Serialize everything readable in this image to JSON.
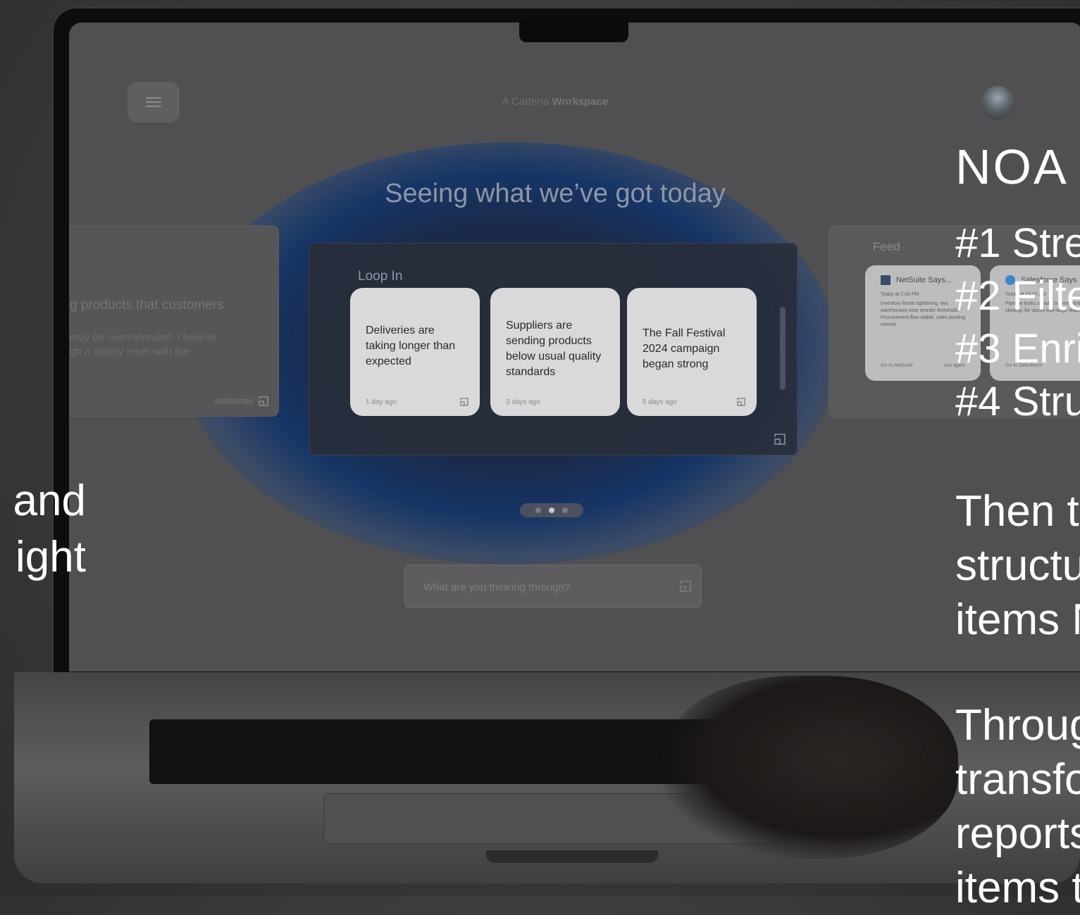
{
  "workspace": {
    "prefix": "A Cartena",
    "name": "Workspace"
  },
  "headline": "Seeing what we’ve got today",
  "left_card": {
    "line1": "g products that customers",
    "line2": "may be overextended. I believe",
    "line3": "gn a quality reset with the",
    "action": "collaborate"
  },
  "loop_in": {
    "title": "Loop In",
    "cards": [
      {
        "text": "Deliveries are taking longer than expected",
        "time": "1 day ago"
      },
      {
        "text": "Suppliers are sending products below usual quality standards",
        "time": "3 days ago"
      },
      {
        "text": "The Fall Festival 2024 campaign began strong",
        "time": "5 days ago"
      }
    ]
  },
  "feed": {
    "title": "Feed",
    "cards": [
      {
        "source": "NetSuite Says...",
        "time": "Today at 2:43 PM",
        "body": "Inventory levels tightening, two warehouses near reorder threshold. Procurement flow stable, sales posting normal",
        "link": "Go to NetSuite",
        "right": "ask again"
      },
      {
        "source": "Salesforce Says",
        "time": "Today at 10:27 AM",
        "body": "Pipeline looks steady, but momentum's slowing, for upsell mid-stage leads. Ma",
        "link": "Go to Salesforce",
        "right": ""
      }
    ]
  },
  "pagination": {
    "count": 3,
    "active": 1
  },
  "prompt": {
    "placeholder": "What are you thinking through?"
  },
  "overlay_left": {
    "line1": "and",
    "line2": "ight"
  },
  "overlay_right": {
    "brand": "NOA",
    "steps": [
      "#1 Stre",
      "#2 Filte",
      "#3 Enri",
      "#4 Stru"
    ],
    "para1": [
      "Then t",
      "structu",
      "items N"
    ],
    "para2": [
      "Throug",
      "transfo",
      "reports",
      "items t"
    ]
  },
  "colors": {
    "glow": "#163566",
    "card": "#d9d9da",
    "screen": "#505052"
  },
  "icons": [
    "menu-icon",
    "avatar",
    "expand-icon",
    "netsuite-logo-icon",
    "salesforce-logo-icon",
    "send-icon"
  ]
}
